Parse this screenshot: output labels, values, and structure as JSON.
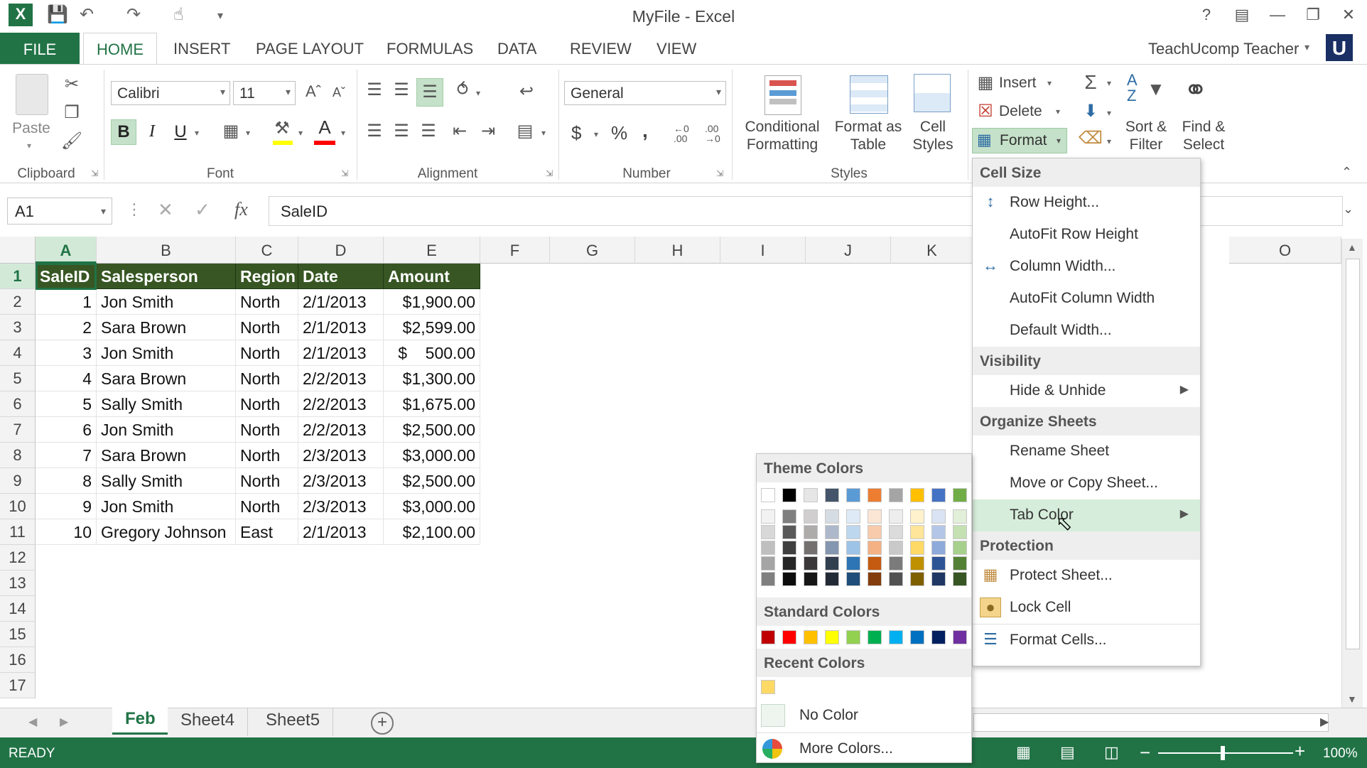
{
  "window": {
    "title": "MyFile - Excel",
    "user": "TeachUcomp Teacher"
  },
  "tabs": [
    {
      "label": "FILE"
    },
    {
      "label": "HOME"
    },
    {
      "label": "INSERT"
    },
    {
      "label": "PAGE LAYOUT"
    },
    {
      "label": "FORMULAS"
    },
    {
      "label": "DATA"
    },
    {
      "label": "REVIEW"
    },
    {
      "label": "VIEW"
    }
  ],
  "ribbon": {
    "clipboard": {
      "paste": "Paste",
      "label": "Clipboard"
    },
    "font": {
      "name": "Calibri",
      "size": "11",
      "label": "Font",
      "bold": "B",
      "italic": "I",
      "underline": "U"
    },
    "alignment": {
      "label": "Alignment"
    },
    "number": {
      "format": "General",
      "label": "Number",
      "dollar": "$",
      "percent": "%",
      "comma": ","
    },
    "styles": {
      "label": "Styles",
      "cond1": "Conditional",
      "cond2": "Formatting",
      "fat1": "Format as",
      "fat2": "Table",
      "cs1": "Cell",
      "cs2": "Styles"
    },
    "cells": {
      "insert": "Insert",
      "delete": "Delete",
      "format": "Format"
    },
    "editing": {
      "sort1": "Sort &",
      "sort2": "Filter",
      "find1": "Find &",
      "find2": "Select"
    }
  },
  "formula_bar": {
    "name_box": "A1",
    "fx": "fx",
    "value": "SaleID"
  },
  "grid": {
    "columns": [
      "A",
      "B",
      "C",
      "D",
      "E",
      "F",
      "G",
      "H",
      "I",
      "J",
      "K",
      "O"
    ],
    "rows": [
      "1",
      "2",
      "3",
      "4",
      "5",
      "6",
      "7",
      "8",
      "9",
      "10",
      "11",
      "12",
      "13",
      "14",
      "15",
      "16",
      "17"
    ],
    "header": [
      "SaleID",
      "Salesperson",
      "Region",
      "Date",
      "Amount"
    ],
    "data": [
      [
        "1",
        "Jon Smith",
        "North",
        "2/1/2013",
        "$1,900.00"
      ],
      [
        "2",
        "Sara Brown",
        "North",
        "2/1/2013",
        "$2,599.00"
      ],
      [
        "3",
        "Jon Smith",
        "North",
        "2/1/2013",
        "$    500.00"
      ],
      [
        "4",
        "Sara Brown",
        "North",
        "2/2/2013",
        "$1,300.00"
      ],
      [
        "5",
        "Sally Smith",
        "North",
        "2/2/2013",
        "$1,675.00"
      ],
      [
        "6",
        "Jon Smith",
        "North",
        "2/2/2013",
        "$2,500.00"
      ],
      [
        "7",
        "Sara Brown",
        "North",
        "2/3/2013",
        "$3,000.00"
      ],
      [
        "8",
        "Sally Smith",
        "North",
        "2/3/2013",
        "$2,500.00"
      ],
      [
        "9",
        "Jon Smith",
        "North",
        "2/3/2013",
        "$3,000.00"
      ],
      [
        "10",
        "Gregory Johnson",
        "East",
        "2/1/2013",
        "$2,100.00"
      ]
    ]
  },
  "sheets": [
    {
      "label": "Feb"
    },
    {
      "label": "Sheet4"
    },
    {
      "label": "Sheet5"
    }
  ],
  "status": {
    "mode": "READY",
    "zoom": "100%"
  },
  "format_menu": {
    "cell_size": "Cell Size",
    "row_height": "Row Height...",
    "autofit_row": "AutoFit Row Height",
    "column_width": "Column Width...",
    "autofit_col": "AutoFit Column Width",
    "default_width": "Default Width...",
    "visibility": "Visibility",
    "hide_unhide": "Hide & Unhide",
    "organize": "Organize Sheets",
    "rename": "Rename Sheet",
    "move_copy": "Move or Copy Sheet...",
    "tab_color": "Tab Color",
    "protection": "Protection",
    "protect_sheet": "Protect Sheet...",
    "lock_cell": "Lock Cell",
    "format_cells": "Format Cells..."
  },
  "color_menu": {
    "theme": "Theme Colors",
    "standard": "Standard Colors",
    "recent": "Recent Colors",
    "no_color": "No Color",
    "more": "More Colors...",
    "theme_top": [
      "#ffffff",
      "#000000",
      "#e7e6e6",
      "#44546a",
      "#5b9bd5",
      "#ed7d31",
      "#a5a5a5",
      "#ffc000",
      "#4472c4",
      "#70ad47"
    ],
    "theme_shades": [
      [
        "#f2f2f2",
        "#7f7f7f",
        "#d0cece",
        "#d6dce4",
        "#deebf6",
        "#fbe5d5",
        "#ededed",
        "#fff2cc",
        "#dae3f3",
        "#e2efd9"
      ],
      [
        "#d8d8d8",
        "#595959",
        "#aeabab",
        "#adb9ca",
        "#bdd7ee",
        "#f7cbac",
        "#dbdbdb",
        "#fee599",
        "#b4c6e7",
        "#c5e0b3"
      ],
      [
        "#bfbfbf",
        "#3f3f3f",
        "#757070",
        "#8496b0",
        "#9dc3e6",
        "#f4b183",
        "#c9c9c9",
        "#ffd965",
        "#8eaadb",
        "#a8d08d"
      ],
      [
        "#a5a5a5",
        "#262626",
        "#3a3838",
        "#323f4f",
        "#2e75b5",
        "#c55a11",
        "#7b7b7b",
        "#bf9000",
        "#2f5496",
        "#538135"
      ],
      [
        "#7f7f7f",
        "#0c0c0c",
        "#171616",
        "#222a35",
        "#1e4e79",
        "#833c0b",
        "#525252",
        "#7f6000",
        "#1f3864",
        "#375623"
      ]
    ],
    "standard_colors": [
      "#c00000",
      "#ff0000",
      "#ffc000",
      "#ffff00",
      "#92d050",
      "#00b050",
      "#00b0f0",
      "#0070c0",
      "#002060",
      "#7030a0"
    ],
    "recent_colors": [
      "#ffd966"
    ]
  }
}
